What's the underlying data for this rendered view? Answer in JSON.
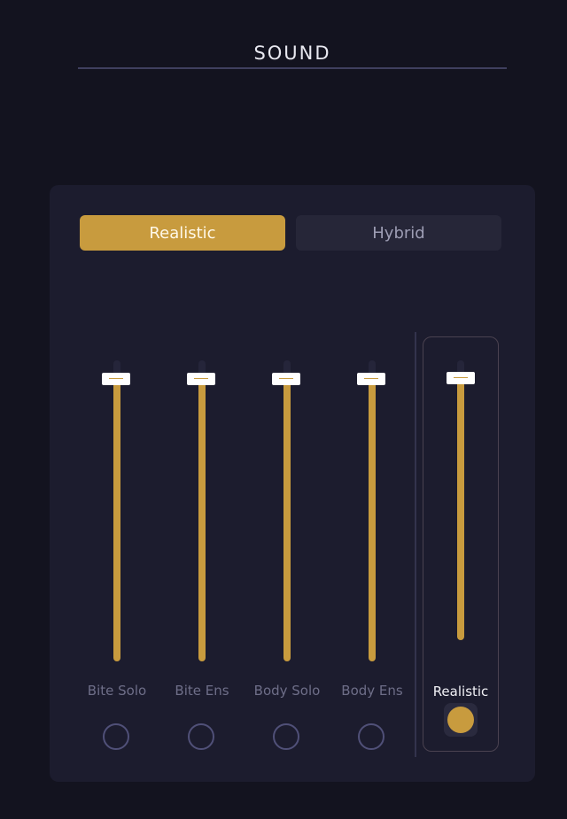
{
  "header": {
    "title": "SOUND"
  },
  "modes": {
    "active": "Realistic",
    "inactive": "Hybrid"
  },
  "channels": [
    {
      "label": "Bite Solo",
      "level": 0.94
    },
    {
      "label": "Bite Ens",
      "level": 0.94
    },
    {
      "label": "Body Solo",
      "level": 0.94
    },
    {
      "label": "Body Ens",
      "level": 0.94
    }
  ],
  "master": {
    "label": "Realistic",
    "level": 0.94,
    "enabled": true
  },
  "colors": {
    "accent": "#c89b3e",
    "panel": "#1c1c2e",
    "background": "#13131f"
  }
}
